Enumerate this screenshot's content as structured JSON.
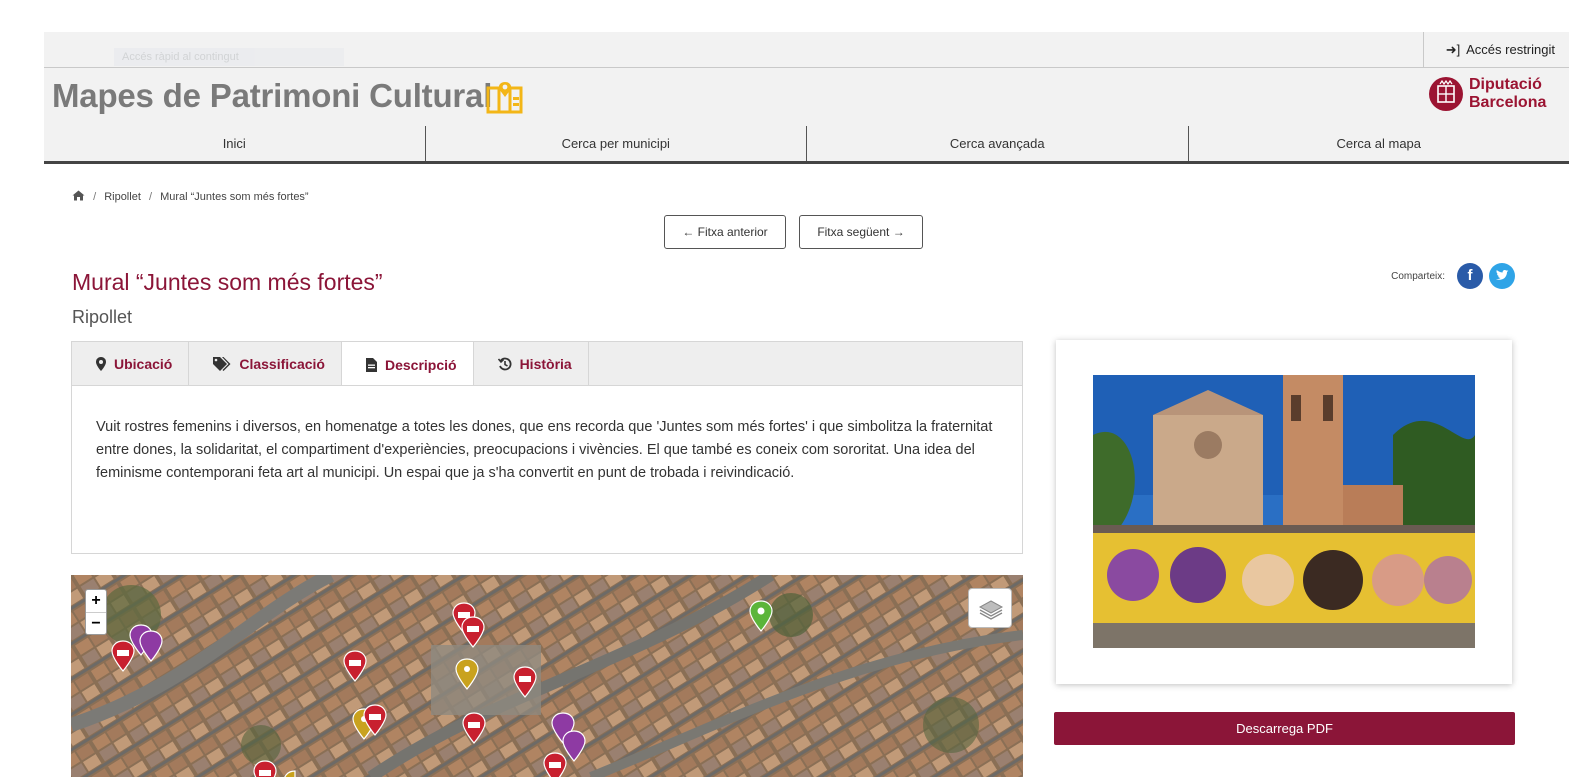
{
  "topbar": {
    "skip_link": "Accés ràpid al contingut",
    "access_label": "Accés restringit"
  },
  "header": {
    "site_title": "Mapes de Patrimoni Cultural",
    "logo_line1": "Diputació",
    "logo_line2": "Barcelona",
    "brand_color": "#8b1538"
  },
  "nav": {
    "items": [
      {
        "label": "Inici"
      },
      {
        "label": "Cerca per municipi"
      },
      {
        "label": "Cerca avançada"
      },
      {
        "label": "Cerca al mapa"
      }
    ]
  },
  "breadcrumb": {
    "items": [
      "Ripollet",
      "Mural “Juntes som més fortes”"
    ]
  },
  "pager": {
    "prev_label": "← Fitxa anterior",
    "next_label": "Fitxa següent →"
  },
  "record": {
    "title": "Mural “Juntes som més fortes”",
    "municipality": "Ripollet"
  },
  "share": {
    "label": "Comparteix:",
    "networks": [
      {
        "icon": "facebook-icon",
        "glyph": "f"
      },
      {
        "icon": "twitter-icon",
        "glyph": "t"
      }
    ]
  },
  "tabs": {
    "items": [
      {
        "label": "Ubicació",
        "icon": "map-marker-icon",
        "glyph": "⬤"
      },
      {
        "label": "Classificació",
        "icon": "tags-icon",
        "glyph": "◆"
      },
      {
        "label": "Descripció",
        "icon": "file-icon",
        "glyph": "▤"
      },
      {
        "label": "Història",
        "icon": "history-icon",
        "glyph": "↺"
      }
    ],
    "active_index": 2,
    "description": "Vuit rostres femenins i diversos, en homenatge a totes les dones, que ens recorda que 'Juntes som més fortes' i que simbolitza la fraternitat entre dones, la solidaritat, el compartiment d'experiències, preocupacions i vivències. El que també es coneix com sororitat. Una idea del feminisme contemporani feta art al municipi. Un espai que ja s'ha convertit en punt de trobada i reivindicació."
  },
  "map": {
    "zoom_in": "+",
    "zoom_out": "−",
    "marker_colors": {
      "monument": "#c8202f",
      "music": "#c9a21e",
      "purple": "#8e3aa3",
      "green": "#5bb53a"
    }
  },
  "side": {
    "pdf_label": "Descarrega PDF"
  }
}
